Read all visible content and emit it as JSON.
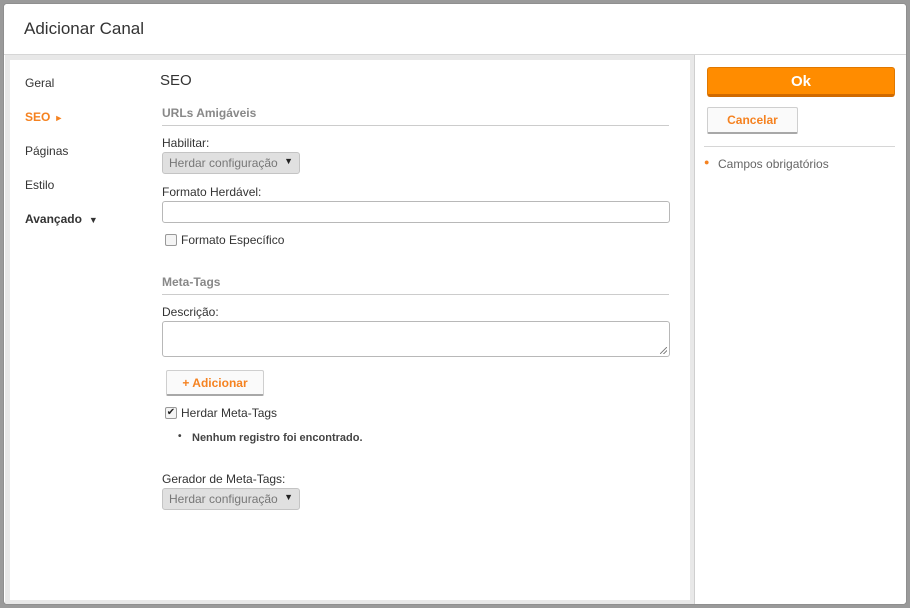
{
  "dialog": {
    "title": "Adicionar Canal"
  },
  "nav": {
    "items": [
      {
        "label": "Geral"
      },
      {
        "label": "SEO",
        "arrow": "►"
      },
      {
        "label": "Páginas"
      },
      {
        "label": "Estilo"
      },
      {
        "label": "Avançado",
        "arrow": "▼"
      }
    ]
  },
  "main": {
    "section_title": "SEO",
    "urls": {
      "title": "URLs Amigáveis",
      "enable_label": "Habilitar:",
      "enable_select_value": "Herdar configuração",
      "format_label": "Formato Herdável:",
      "format_value": "",
      "specific_checkbox_label": "Formato Específico",
      "specific_checked": false
    },
    "metatags": {
      "title": "Meta-Tags",
      "description_label": "Descrição:",
      "description_value": "",
      "add_button_label": "+ Adicionar",
      "inherit_checkbox_label": "Herdar Meta-Tags",
      "inherit_checked": true,
      "empty_message": "Nenhum registro foi encontrado.",
      "generator_label": "Gerador de Meta-Tags:",
      "generator_select_value": "Herdar configuração"
    },
    "caret": "▼"
  },
  "sidebar": {
    "ok_label": "Ok",
    "cancel_label": "Cancelar",
    "required_note": "Campos obrigatórios",
    "required_marker": "●"
  },
  "colors": {
    "accent": "#f58220",
    "ok_button": "#ff8c00"
  }
}
